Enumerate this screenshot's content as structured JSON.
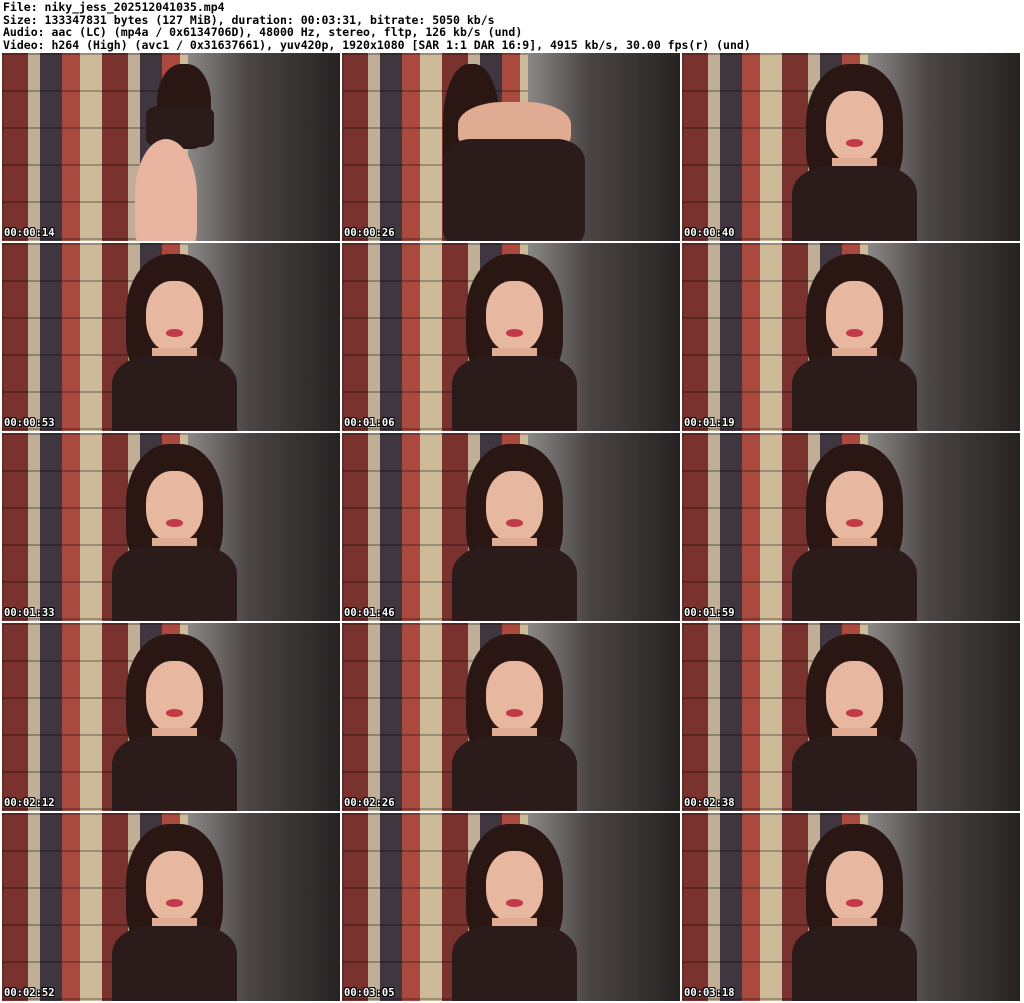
{
  "header": {
    "file_line": "File: niky_jess_202512041035.mp4",
    "size_line": "Size: 133347831 bytes (127 MiB), duration: 00:03:31, bitrate: 5050 kb/s",
    "audio_line": "Audio: aac (LC) (mp4a / 0x6134706D), 48000 Hz, stereo, fltp, 126 kb/s (und)",
    "video_line": "Video: h264 (High) (avc1 / 0x31637661), yuv420p, 1920x1080 [SAR 1:1 DAR 16:9], 4915 kb/s, 30.00 fps(r) (und)"
  },
  "thumbnails": [
    {
      "timestamp": "00:00:14",
      "scene": "back"
    },
    {
      "timestamp": "00:00:26",
      "scene": "close"
    },
    {
      "timestamp": "00:00:40",
      "scene": "seated"
    },
    {
      "timestamp": "00:00:53",
      "scene": "seated"
    },
    {
      "timestamp": "00:01:06",
      "scene": "seated"
    },
    {
      "timestamp": "00:01:19",
      "scene": "seated"
    },
    {
      "timestamp": "00:01:33",
      "scene": "seated"
    },
    {
      "timestamp": "00:01:46",
      "scene": "seated"
    },
    {
      "timestamp": "00:01:59",
      "scene": "seated"
    },
    {
      "timestamp": "00:02:12",
      "scene": "seated"
    },
    {
      "timestamp": "00:02:26",
      "scene": "seated"
    },
    {
      "timestamp": "00:02:38",
      "scene": "seated"
    },
    {
      "timestamp": "00:02:52",
      "scene": "seated"
    },
    {
      "timestamp": "00:03:05",
      "scene": "seated"
    },
    {
      "timestamp": "00:03:18",
      "scene": "seated"
    }
  ],
  "colors": {
    "timestamp_text": "#ffffff",
    "timestamp_outline": "#000000",
    "header_text": "#000000",
    "background": "#ffffff"
  }
}
